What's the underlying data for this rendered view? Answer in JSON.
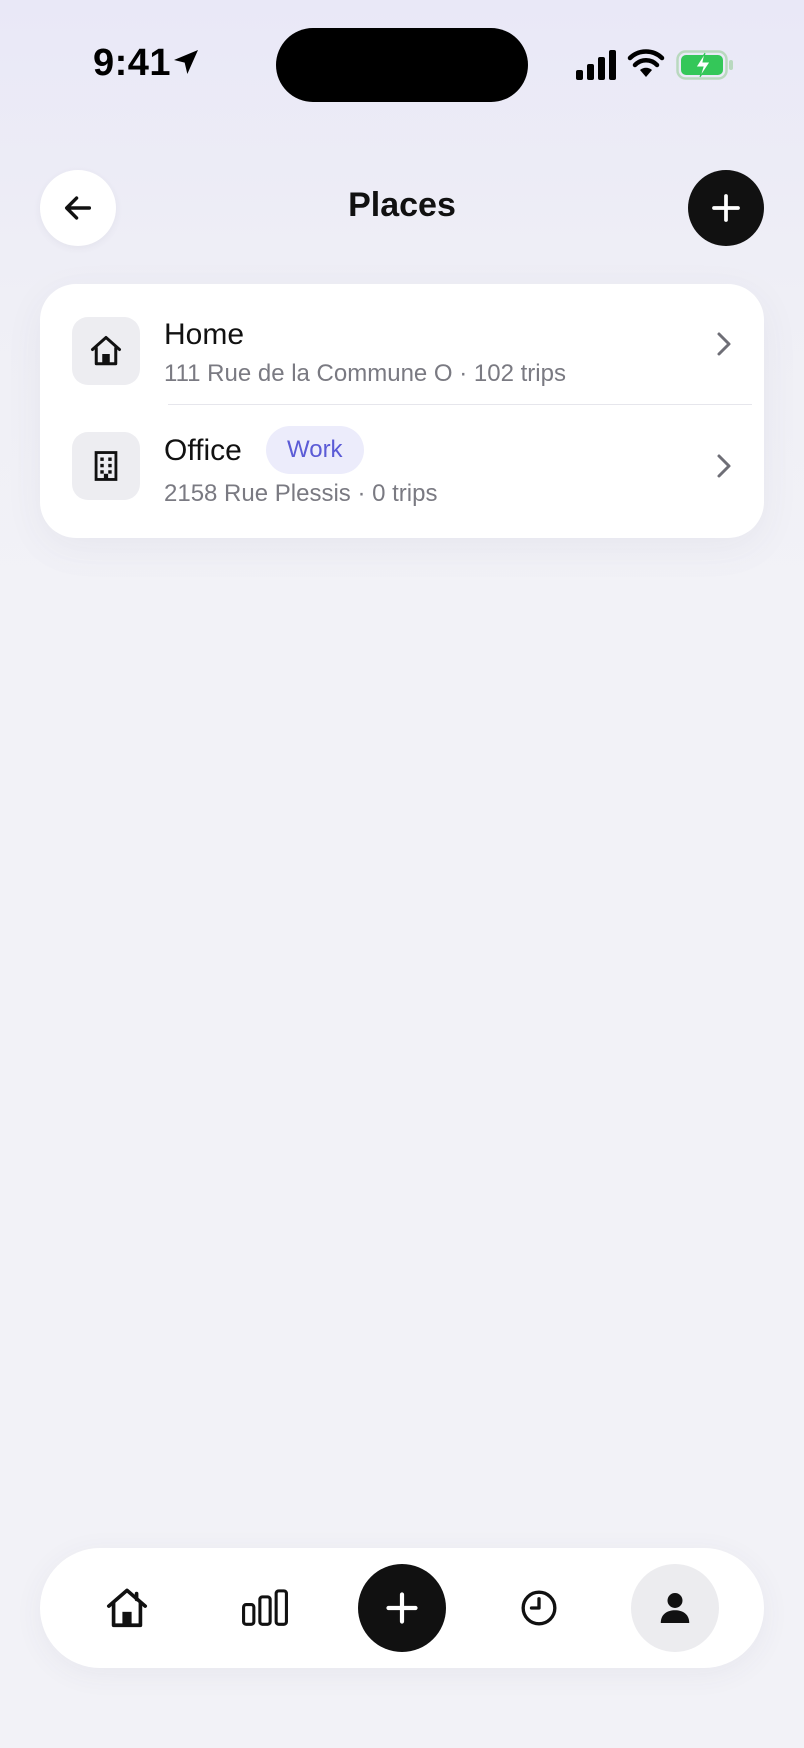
{
  "status_bar": {
    "time": "9:41",
    "icons": [
      "location-arrow-icon",
      "cellular-signal-icon",
      "wifi-icon",
      "battery-charging-icon"
    ],
    "battery_color": "#34c759"
  },
  "header": {
    "title": "Places",
    "back_icon": "arrow-left-icon",
    "add_icon": "plus-icon"
  },
  "places": [
    {
      "icon": "house-icon",
      "name": "Home",
      "subtitle": "111 Rue de la Commune O · 102 trips",
      "tag": ""
    },
    {
      "icon": "office-building-icon",
      "name": "Office",
      "subtitle": "2158 Rue Plessis · 0 trips",
      "tag": "Work"
    }
  ],
  "tab_bar": {
    "items": [
      {
        "icon": "home-icon",
        "active": false
      },
      {
        "icon": "bar-chart-icon",
        "active": false
      },
      {
        "icon": "plus-icon",
        "active": false
      },
      {
        "icon": "clock-icon",
        "active": false
      },
      {
        "icon": "person-icon",
        "active": true
      }
    ]
  },
  "colors": {
    "accent_tag_text": "#5b5bd6",
    "accent_tag_bg": "#ececfb",
    "primary_dark": "#111111"
  }
}
